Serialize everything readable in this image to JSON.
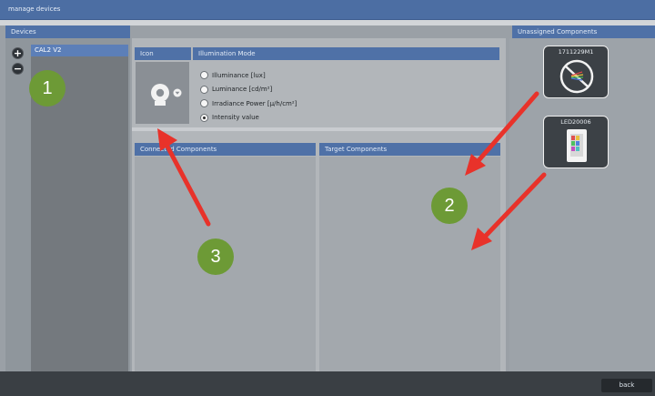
{
  "window": {
    "title": "manage devices"
  },
  "devices": {
    "header": "Devices",
    "add_icon": "plus-circle-icon",
    "remove_icon": "minus-circle-icon",
    "items": [
      {
        "label": "CAL2 V2"
      }
    ]
  },
  "config": {
    "icon_header": "Icon",
    "mode_header": "Illumination Mode",
    "device_icon": "camera-icon",
    "modes": [
      {
        "label": "Illuminance [lux]",
        "checked": false
      },
      {
        "label": "Luminance [cd/m²]",
        "checked": false
      },
      {
        "label": "Irradiance Power [µ/h/cm²]",
        "checked": false
      },
      {
        "label": "Intensity value",
        "checked": true
      }
    ]
  },
  "components": {
    "connected_header": "Connected Components",
    "target_header": "Target Components"
  },
  "unassigned": {
    "header": "Unassigned Components",
    "items": [
      {
        "id": "1711229M1",
        "icon": "optic-lens-icon"
      },
      {
        "id": "LED20006",
        "icon": "led-panel-icon"
      }
    ]
  },
  "footer": {
    "back_label": "back"
  },
  "annotations": {
    "marker_1": "1",
    "marker_2": "2",
    "marker_3": "3",
    "arrow_color": "#e8322a",
    "marker_color": "#6d9a36"
  }
}
